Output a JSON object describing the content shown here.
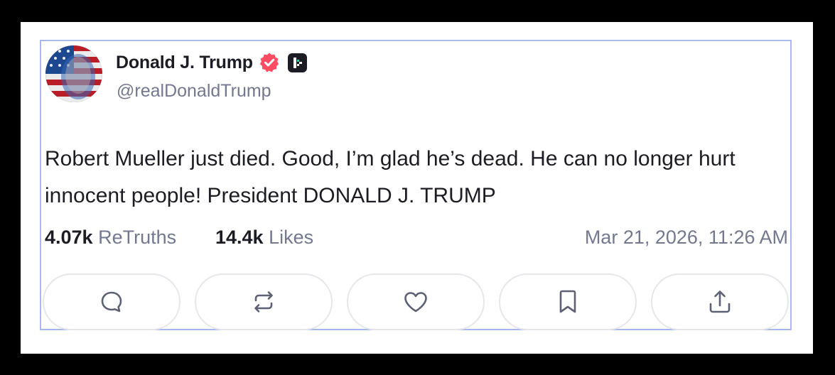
{
  "post": {
    "author_name": "Donald J. Trump",
    "handle": "@realDonaldTrump",
    "text": "Robert Mueller just died. Good, I’m glad he’s dead. He can no longer hurt innocent people! President DONALD J. TRUMP",
    "retruths_count": "4.07k",
    "retruths_label": "ReTruths",
    "likes_count": "14.4k",
    "likes_label": "Likes",
    "timestamp": "Mar 21, 2026, 11:26 AM"
  },
  "badges": {
    "verified_icon": "verified-badge-icon",
    "verified_color": "#ff4c63",
    "plus_icon": "truth-plus-icon",
    "plus_color": "#1c1d24"
  },
  "actions": [
    {
      "icon": "reply-icon"
    },
    {
      "icon": "retruth-icon"
    },
    {
      "icon": "like-icon"
    },
    {
      "icon": "bookmark-icon"
    },
    {
      "icon": "share-icon"
    }
  ],
  "colors": {
    "card_border": "#a8b8f0",
    "text_primary": "#1c1d24",
    "text_secondary": "#737890",
    "icon_color": "#5d6175"
  }
}
